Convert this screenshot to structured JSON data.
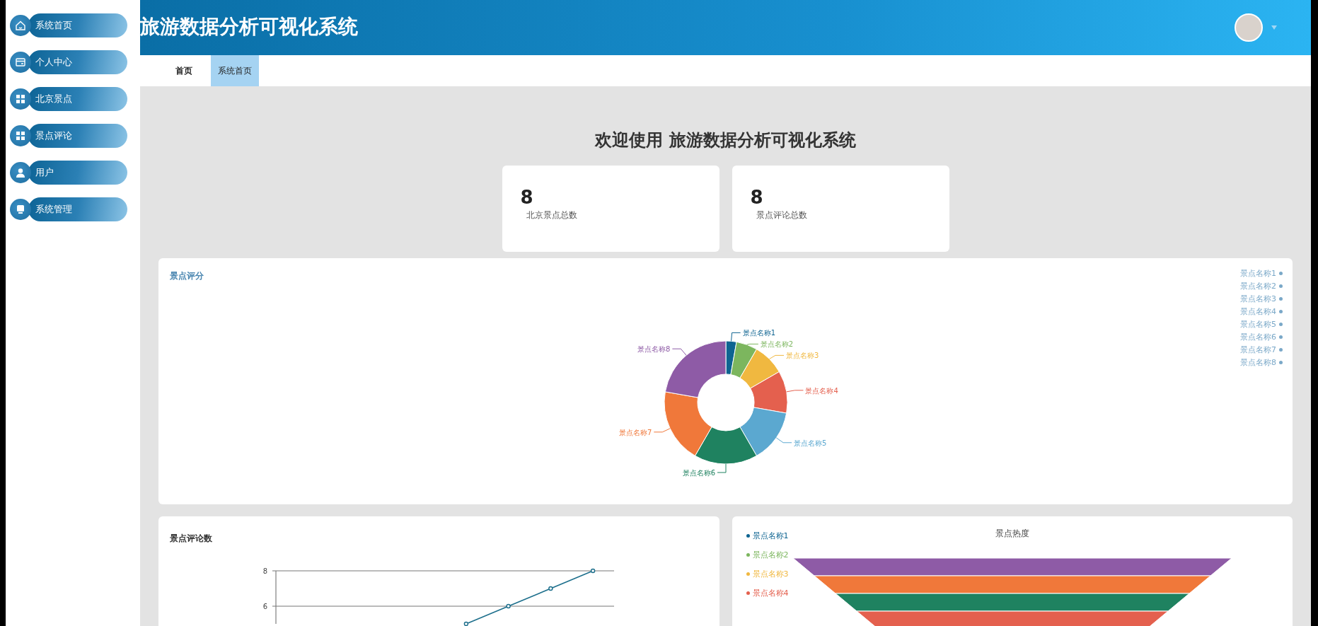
{
  "sidebar": {
    "items": [
      {
        "label": "系统首页"
      },
      {
        "label": "个人中心"
      },
      {
        "label": "北京景点"
      },
      {
        "label": "景点评论"
      },
      {
        "label": "用户"
      },
      {
        "label": "系统管理"
      }
    ]
  },
  "header": {
    "title": "旅游数据分析可视化系统"
  },
  "tabs": [
    {
      "label": "首页",
      "selected": false
    },
    {
      "label": "系统首页",
      "selected": true
    }
  ],
  "welcome": "欢迎使用 旅游数据分析可视化系统",
  "stats": [
    {
      "value": "8",
      "label": "北京景点总数"
    },
    {
      "value": "8",
      "label": "景点评论总数"
    }
  ],
  "score_card": {
    "title": "景点评分",
    "chart_data": {
      "type": "donut",
      "categories": [
        "景点名称1",
        "景点名称2",
        "景点名称3",
        "景点名称4",
        "景点名称5",
        "景点名称6",
        "景点名称7",
        "景点名称8"
      ],
      "series": [
        {
          "colors": [
            "#0e6491",
            "#7cb65e",
            "#f0b840",
            "#e4604e",
            "#5ba8d0",
            "#1f8260",
            "#f0783a",
            "#8e5ba6"
          ],
          "values": [
            1,
            2,
            3,
            4,
            5,
            6,
            7,
            8
          ]
        }
      ]
    }
  },
  "comments_card": {
    "title": "景点评论数",
    "chart_data": {
      "type": "line",
      "ylim": [
        5,
        8
      ],
      "yticks": [
        6,
        8
      ],
      "series": [
        {
          "color": "#1d6f8c",
          "marker": true,
          "values": [
            null,
            null,
            null,
            null,
            5,
            6,
            7,
            8
          ]
        }
      ]
    }
  },
  "heat_card": {
    "title": "景点热度",
    "legend": [
      {
        "label": "景点名称1",
        "color": "#0e6491"
      },
      {
        "label": "景点名称2",
        "color": "#7cb65e"
      },
      {
        "label": "景点名称3",
        "color": "#f0b840"
      },
      {
        "label": "景点名称4",
        "color": "#e4604e"
      }
    ]
  }
}
